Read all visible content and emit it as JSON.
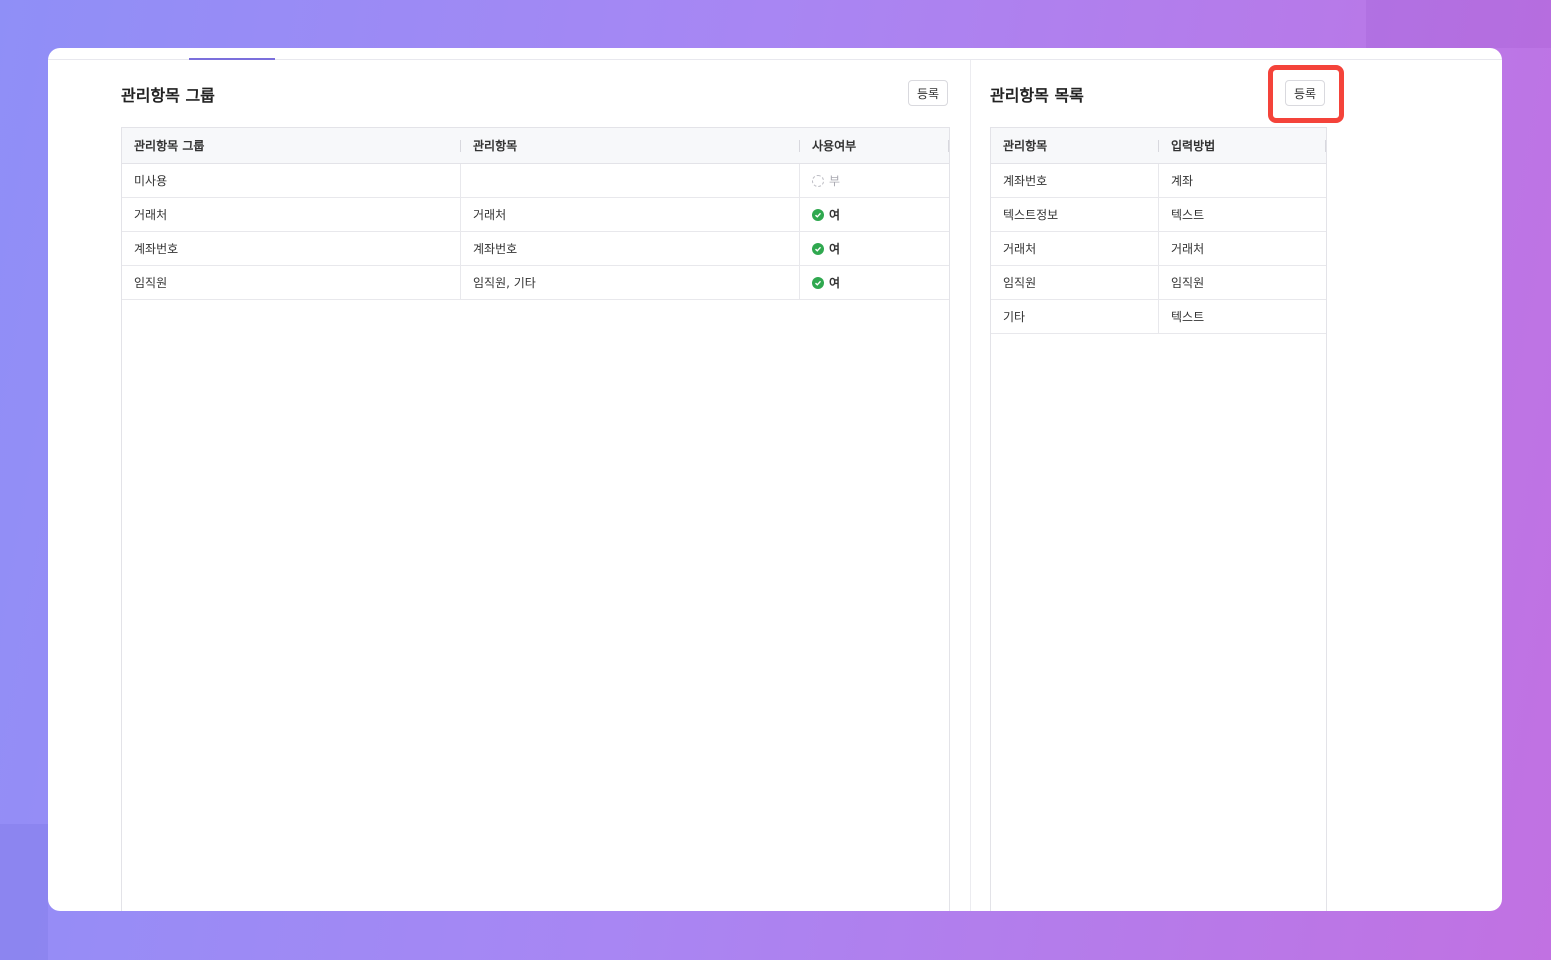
{
  "left_panel": {
    "title": "관리항목 그룹",
    "register_label": "등록",
    "columns": [
      "관리항목 그룹",
      "관리항목",
      "사용여부"
    ],
    "rows": [
      {
        "group": "미사용",
        "items": "",
        "usage": "부",
        "enabled": false
      },
      {
        "group": "거래처",
        "items": "거래처",
        "usage": "여",
        "enabled": true
      },
      {
        "group": "계좌번호",
        "items": "계좌번호",
        "usage": "여",
        "enabled": true
      },
      {
        "group": "임직원",
        "items": "임직원, 기타",
        "usage": "여",
        "enabled": true
      }
    ]
  },
  "right_panel": {
    "title": "관리항목 목록",
    "register_label": "등록",
    "columns": [
      "관리항목",
      "입력방법"
    ],
    "rows": [
      {
        "item": "계좌번호",
        "method": "계좌"
      },
      {
        "item": "텍스트정보",
        "method": "텍스트"
      },
      {
        "item": "거래처",
        "method": "거래처"
      },
      {
        "item": "임직원",
        "method": "임직원"
      },
      {
        "item": "기타",
        "method": "텍스트"
      }
    ]
  },
  "colors": {
    "accent": "#7b6fdc",
    "success": "#2fa84f",
    "highlight": "#f4433a"
  }
}
